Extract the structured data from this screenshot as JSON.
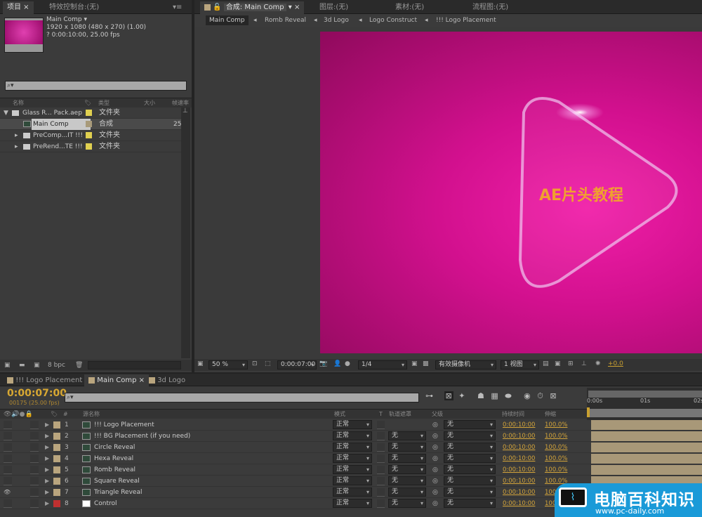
{
  "project_panel": {
    "tabs": [
      "项目",
      "特效控制台:(无)"
    ],
    "comp_info": {
      "name": "Main Comp ▾",
      "size": "1920 x 1080  (480 x 270) (1.00)",
      "duration": "? 0:00:10:00, 25.00 fps"
    },
    "search_placeholder": "",
    "columns": [
      "名称",
      "类型",
      "大小",
      "帧速率"
    ],
    "items": [
      {
        "name": "Glass R... Pack.aep",
        "type": "文件夹",
        "size": "",
        "fps": "",
        "color": "#e0d050"
      },
      {
        "name": "Main Comp",
        "type": "合成",
        "size": "",
        "fps": "25",
        "color": "#a89a7a"
      },
      {
        "name": "PreComp...IT !!!",
        "type": "文件夹",
        "size": "",
        "fps": "",
        "color": "#e0d050"
      },
      {
        "name": "PreRend...TE !!!",
        "type": "文件夹",
        "size": "",
        "fps": "",
        "color": "#e0d050"
      }
    ],
    "bpc": "8 bpc"
  },
  "comp_panel": {
    "tabs": [
      "合成: Main Comp",
      "图层:(无)",
      "素材:(无)",
      "流程图:(无)"
    ],
    "breadcrumbs": [
      "Main Comp",
      "Romb Reveal",
      "3d Logo",
      "Logo Construct",
      "!!! Logo Placement"
    ],
    "viewer_text": "AE片头教程",
    "toolbar": {
      "zoom": "50 %",
      "timecode": "0:00:07:00",
      "resolution": "1/4",
      "camera": "有效摄像机",
      "views": "1 视图",
      "exposure": "+0.0"
    }
  },
  "timeline": {
    "tabs": [
      "!!! Logo Placement",
      "Main Comp",
      "3d Logo"
    ],
    "current_time": "0:00:07:00",
    "frame_info": "00175 (25.00 fps)",
    "columns": {
      "source": "源名称",
      "mode": "模式",
      "t": "T",
      "track_matte": "轨道遮罩",
      "parent": "父级",
      "duration": "持续时间",
      "stretch": "伸缩"
    },
    "ruler": [
      "0:00s",
      "01s",
      "02s"
    ],
    "layers": [
      {
        "num": "1",
        "name": "!!! Logo Placement",
        "color": "#b9a57e",
        "mode": "正常",
        "matte": "",
        "parent": "无",
        "duration": "0:00:10:00",
        "stretch": "100.0%",
        "visible": false
      },
      {
        "num": "2",
        "name": "!!! BG Placement (if you need)",
        "color": "#b9a57e",
        "mode": "正常",
        "matte": "无",
        "parent": "无",
        "duration": "0:00:10:00",
        "stretch": "100.0%",
        "visible": false
      },
      {
        "num": "3",
        "name": "Circle Reveal",
        "color": "#b9a57e",
        "mode": "正常",
        "matte": "无",
        "parent": "无",
        "duration": "0:00:10:00",
        "stretch": "100.0%",
        "visible": false
      },
      {
        "num": "4",
        "name": "Hexa Reveal",
        "color": "#b9a57e",
        "mode": "正常",
        "matte": "无",
        "parent": "无",
        "duration": "0:00:10:00",
        "stretch": "100.0%",
        "visible": false
      },
      {
        "num": "5",
        "name": "Romb Reveal",
        "color": "#b9a57e",
        "mode": "正常",
        "matte": "无",
        "parent": "无",
        "duration": "0:00:10:00",
        "stretch": "100.0%",
        "visible": false
      },
      {
        "num": "6",
        "name": "Square Reveal",
        "color": "#b9a57e",
        "mode": "正常",
        "matte": "无",
        "parent": "无",
        "duration": "0:00:10:00",
        "stretch": "100.0%",
        "visible": false
      },
      {
        "num": "7",
        "name": "Triangle Reveal",
        "color": "#b9a57e",
        "mode": "正常",
        "matte": "无",
        "parent": "无",
        "duration": "0:00:10:00",
        "stretch": "100.0%",
        "visible": true
      },
      {
        "num": "8",
        "name": "Control",
        "color": "#c03030",
        "mode": "正常",
        "matte": "无",
        "parent": "无",
        "duration": "0:00:10:00",
        "stretch": "100.0%",
        "visible": false
      }
    ]
  },
  "watermark": {
    "title": "电脑百科知识",
    "url": "www.pc-daily.com"
  }
}
